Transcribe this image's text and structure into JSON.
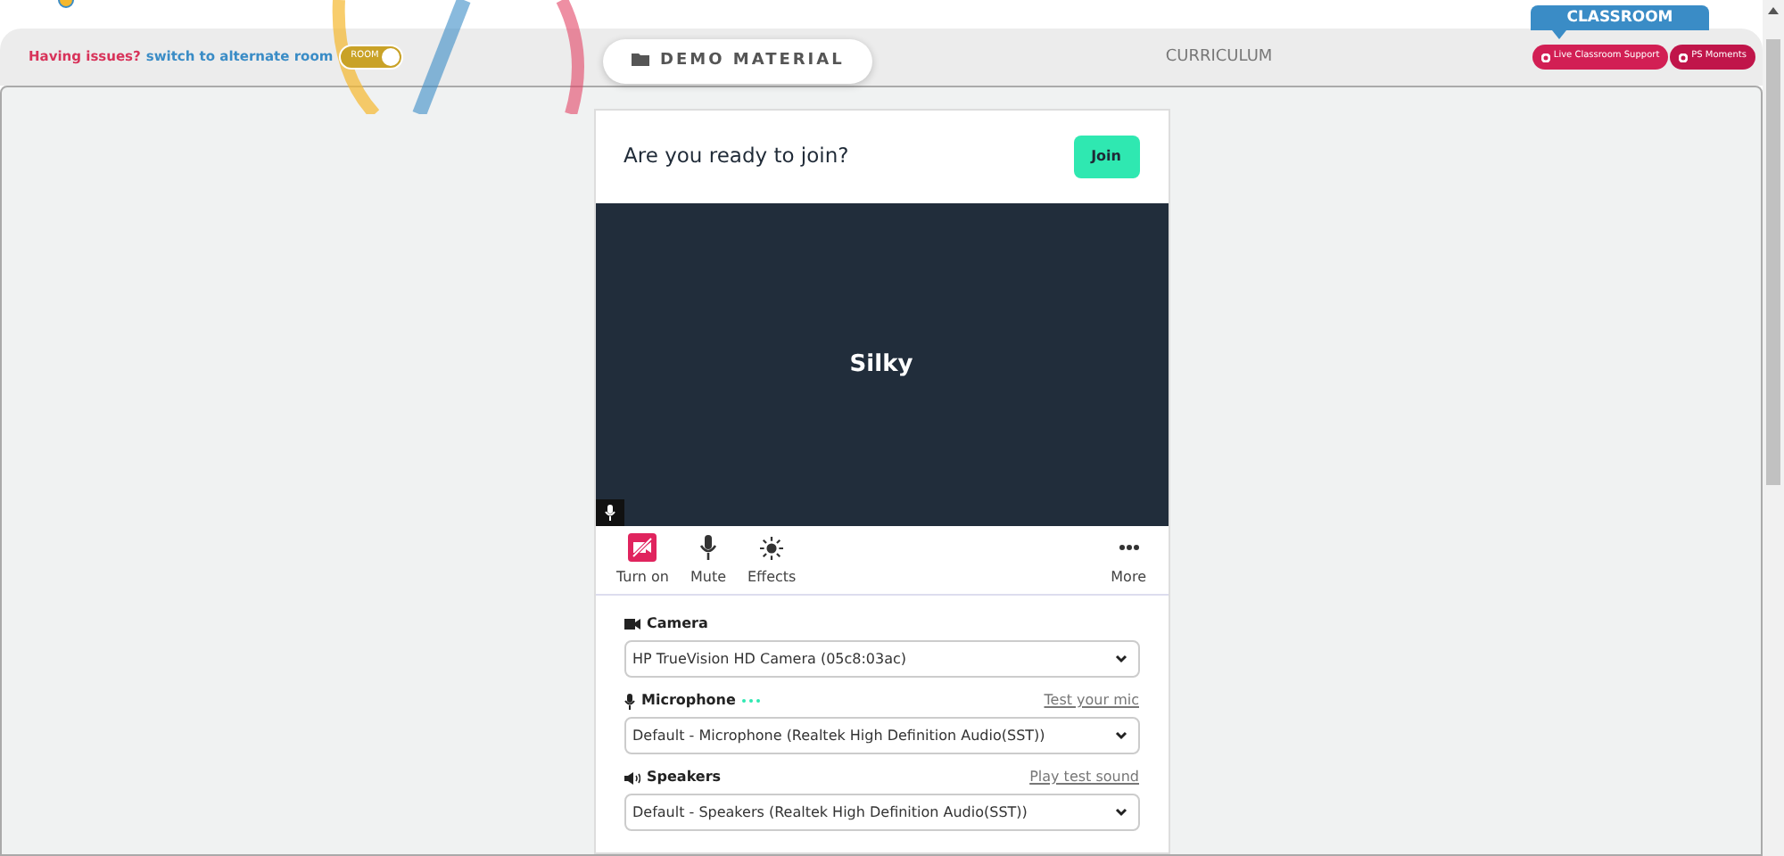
{
  "header": {
    "issue_text": "Having issues?",
    "switch_link": "switch to alternate room",
    "room_toggle": {
      "label": "ROOM",
      "on": true
    },
    "classroom_label": "CLASSROOM",
    "tabs": [
      {
        "label": "DEMO MATERIAL",
        "selected": true
      },
      {
        "label": "CURRICULUM",
        "selected": false
      }
    ],
    "buttons": [
      {
        "label": "Live Classroom Support"
      },
      {
        "label": "PS Moments"
      }
    ]
  },
  "prejoin": {
    "title": "Are you ready to join?",
    "join_button": "Join",
    "participant_name": "Silky",
    "controls": [
      {
        "kind": "camera",
        "label": "Turn on",
        "off": true
      },
      {
        "kind": "mic",
        "label": "Mute",
        "off": false
      },
      {
        "kind": "effects",
        "label": "Effects",
        "off": false
      },
      {
        "kind": "more",
        "label": "More",
        "off": false
      }
    ],
    "devices": [
      {
        "kind": "camera",
        "label": "Camera",
        "value": "HP TrueVision HD Camera (05c8:03ac)"
      },
      {
        "kind": "mic",
        "label": "Microphone",
        "link": "Test your mic",
        "value": "Default - Microphone (Realtek High Definition Audio(SST))"
      },
      {
        "kind": "speaker",
        "label": "Speakers",
        "link": "Play test sound",
        "value": "Default - Speakers (Realtek High Definition Audio(SST))"
      }
    ]
  }
}
